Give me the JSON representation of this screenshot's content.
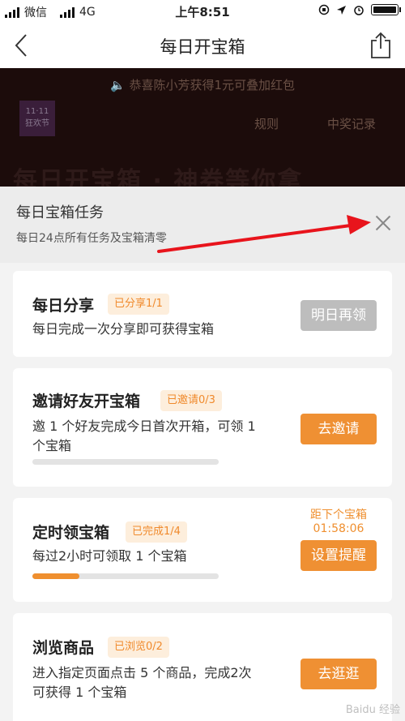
{
  "status_bar": {
    "carrier": "微信",
    "network": "4G",
    "time": "上午8:51",
    "battery_level": 1.0
  },
  "nav": {
    "title": "每日开宝箱"
  },
  "banner": {
    "ticker": "恭喜陈小芳获得1元可叠加红包",
    "badge_line1": "11·11",
    "badge_line2": "狂欢节",
    "rules_label": "规则",
    "records_label": "中奖记录",
    "headline": "每日开宝箱 · 神券等你拿"
  },
  "sheet": {
    "title": "每日宝箱任务",
    "subtitle": "每日24点所有任务及宝箱清零"
  },
  "tasks": [
    {
      "title": "每日分享",
      "badge": "已分享1/1",
      "desc": "每日完成一次分享即可获得宝箱",
      "button": "明日再领",
      "progress": null
    },
    {
      "title": "邀请好友开宝箱",
      "badge": "已邀请0/3",
      "desc_line1": "邀 1 个好友完成今日首次开箱，可领 1",
      "desc_line2": "个宝箱",
      "button": "去邀请",
      "progress": 0.0
    },
    {
      "title": "定时领宝箱",
      "badge": "已完成1/4",
      "desc": "每过2小时可领取 1 个宝箱",
      "countdown_label": "距下个宝箱",
      "countdown_time": "01:58:06",
      "button": "设置提醒",
      "progress": 0.25
    },
    {
      "title": "浏览商品",
      "badge": "已浏览0/2",
      "desc_line1": "进入指定页面点击 5 个商品，完成2次",
      "desc_line2": "可获得 1 个宝箱",
      "button": "去逛逛",
      "progress": 0.0
    }
  ],
  "colors": {
    "accent": "#ef9033",
    "disabled": "#bdbdbd",
    "badge_bg": "#fdeedc",
    "arrow": "#e8141c"
  },
  "watermark": "Baidu 经验"
}
